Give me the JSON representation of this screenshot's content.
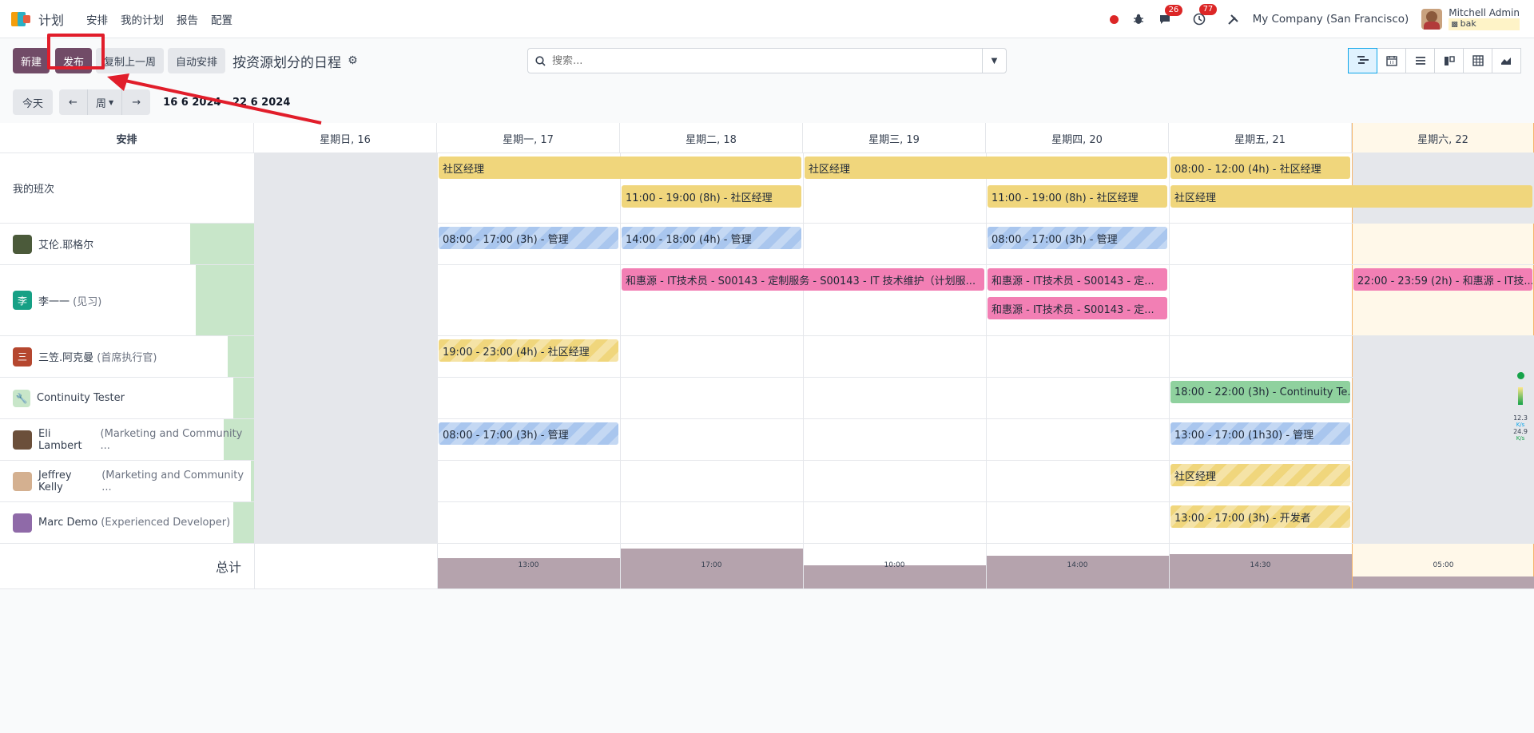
{
  "app": {
    "name": "计划"
  },
  "topmenu": [
    "安排",
    "我的计划",
    "报告",
    "配置"
  ],
  "topright": {
    "chat_count": "26",
    "activity_count": "77",
    "company": "My Company (San Francisco)",
    "user_name": "Mitchell Admin",
    "db": "bak"
  },
  "toolbar": {
    "new_label": "新建",
    "publish_label": "发布",
    "copy_label": "复制上一周",
    "auto_label": "自动安排",
    "view_title": "按资源划分的日程"
  },
  "search": {
    "placeholder": "搜索..."
  },
  "nav": {
    "today": "今天",
    "period": "周",
    "range": "16 6 2024 - 22 6 2024"
  },
  "grid": {
    "group_header": "安排",
    "days": [
      "星期日, 16",
      "星期一, 17",
      "星期二, 18",
      "星期三, 19",
      "星期四, 20",
      "星期五, 21",
      "星期六, 22"
    ],
    "rows": [
      {
        "name": "我的班次",
        "sub": ""
      },
      {
        "name": "艾伦.耶格尔",
        "sub": ""
      },
      {
        "name": "李一一",
        "sub": "(见习)"
      },
      {
        "name": "三笠.阿克曼",
        "sub": "(首席执行官)"
      },
      {
        "name": "Continuity Tester",
        "sub": ""
      },
      {
        "name": "Eli Lambert",
        "sub": "(Marketing and Community ..."
      },
      {
        "name": "Jeffrey Kelly",
        "sub": "(Marketing and Community ..."
      },
      {
        "name": "Marc Demo",
        "sub": "(Experienced Developer)"
      }
    ],
    "shifts": {
      "s1": "社区经理",
      "s2": "社区经理",
      "s3": "08:00 - 12:00 (4h) - 社区经理",
      "s4": "11:00 - 19:00 (8h) - 社区经理",
      "s5": "11:00 - 19:00 (8h) - 社区经理",
      "s6": "社区经理",
      "s7": "08:00 - 17:00 (3h) - 管理",
      "s8": "14:00 - 18:00 (4h) - 管理",
      "s9": "08:00 - 17:00 (3h) - 管理",
      "s10": "和惠源 - IT技术员 - S00143 - 定制服务 - S00143 - IT 技术维护（计划服...",
      "s11": "和惠源 - IT技术员 - S00143 - 定...",
      "s12": "和惠源 - IT技术员 - S00143 - 定...",
      "s13": "22:00 - 23:59 (2h) - 和惠源 - IT技...",
      "s14": "19:00 - 23:00 (4h) - 社区经理",
      "s15": "18:00 - 22:00 (3h) - Continuity Te...",
      "s16": "08:00 - 17:00 (3h) - 管理",
      "s17": "13:00 - 17:00 (1h30) - 管理",
      "s18": "社区经理",
      "s19": "13:00 - 17:00 (3h) - 开发者"
    },
    "total_label": "总计",
    "totals": [
      {
        "day": "星期一, 17",
        "label": "13:00",
        "hours": 13
      },
      {
        "day": "星期二, 18",
        "label": "17:00",
        "hours": 17
      },
      {
        "day": "星期三, 19",
        "label": "10:00",
        "hours": 10
      },
      {
        "day": "星期四, 20",
        "label": "14:00",
        "hours": 14
      },
      {
        "day": "星期五, 21",
        "label": "14:30",
        "hours": 14.5
      },
      {
        "day": "星期六, 22",
        "label": "05:00",
        "hours": 5
      }
    ]
  },
  "widget": {
    "up": "12.3",
    "down": "24.9",
    "unit": "K/s"
  }
}
